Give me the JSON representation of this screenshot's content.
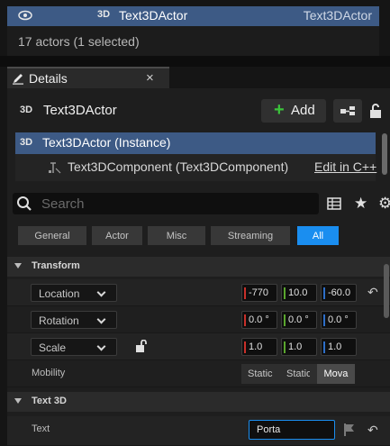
{
  "outliner": {
    "selected_row": {
      "type_badge": "3D",
      "name": "Text3DActor",
      "type": "Text3DActor"
    },
    "status": "17 actors (1 selected)"
  },
  "details_tab": {
    "label": "Details",
    "close": "×"
  },
  "header": {
    "type_badge": "3D",
    "actor_name": "Text3DActor",
    "add_label": "Add",
    "add_plus": "+"
  },
  "components": {
    "instance": {
      "type_badge": "3D",
      "label": "Text3DActor (Instance)"
    },
    "component": {
      "label": "Text3DComponent (Text3DComponent)",
      "edit_link": "Edit in C++"
    }
  },
  "search": {
    "placeholder": "Search",
    "value": ""
  },
  "icons": {
    "star": "★",
    "gear": "⚙"
  },
  "filters": [
    "General",
    "Actor",
    "Misc",
    "Streaming",
    "All"
  ],
  "active_filter": "All",
  "transform": {
    "section_label": "Transform",
    "location": {
      "label": "Location",
      "x": "-770",
      "y": "10.0",
      "z": "-60.0"
    },
    "rotation": {
      "label": "Rotation",
      "x": "0.0 °",
      "y": "0.0 °",
      "z": "0.0 °"
    },
    "scale": {
      "label": "Scale",
      "x": "1.0",
      "y": "1.0",
      "z": "1.0"
    },
    "mobility": {
      "label": "Mobility",
      "options": [
        "Static",
        "Stationary",
        "Movable"
      ],
      "selected": "Movable"
    }
  },
  "text3d": {
    "section_label": "Text 3D",
    "text_label": "Text",
    "text_value": "Porta"
  },
  "reset_glyph": "↶",
  "colors": {
    "selection": "#3d5a85",
    "accent": "#1a8ef0",
    "x_axis": "#c8302a",
    "y_axis": "#5aa62d",
    "z_axis": "#2d6ec8",
    "add_plus": "#3bc43b"
  }
}
